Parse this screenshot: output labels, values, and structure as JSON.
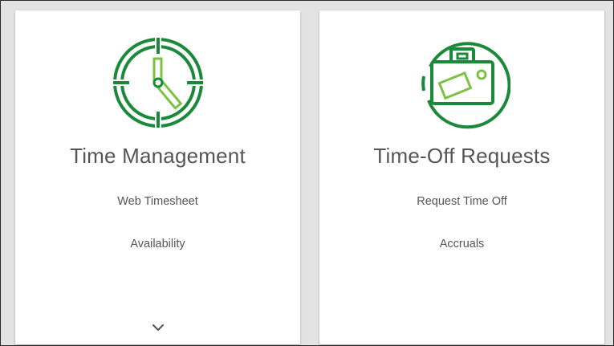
{
  "cards": [
    {
      "title": "Time Management",
      "icon": "clock-icon",
      "links": [
        "Web Timesheet",
        "Availability"
      ],
      "has_expand": true
    },
    {
      "title": "Time-Off Requests",
      "icon": "suitcase-icon",
      "links": [
        "Request Time Off",
        "Accruals"
      ],
      "has_expand": false
    }
  ],
  "colors": {
    "icon_dark_green": "#1a8a3a",
    "icon_light_green": "#7cc242",
    "text": "#555555",
    "background": "#e3e3e3",
    "card": "#ffffff"
  }
}
